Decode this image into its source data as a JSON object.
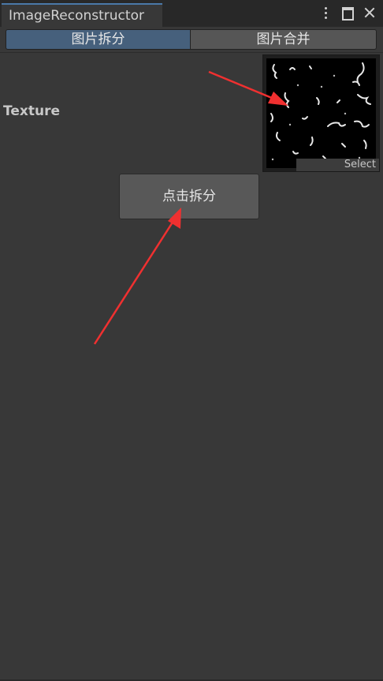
{
  "window": {
    "tab_title": "ImageReconstructor"
  },
  "title_controls": {
    "menu_icon": "kebab-vertical-icon",
    "maximize_icon": "maximize-icon",
    "close_icon": "close-icon"
  },
  "toolbar": {
    "tabs": [
      {
        "label": "图片拆分",
        "active": true
      },
      {
        "label": "图片合并",
        "active": false
      }
    ]
  },
  "texture_field": {
    "label": "Texture",
    "select_label": "Select"
  },
  "actions": {
    "split_label": "点击拆分"
  },
  "colors": {
    "background": "#383838",
    "active_tab": "#46607c",
    "annotation_arrow": "#f03030"
  }
}
